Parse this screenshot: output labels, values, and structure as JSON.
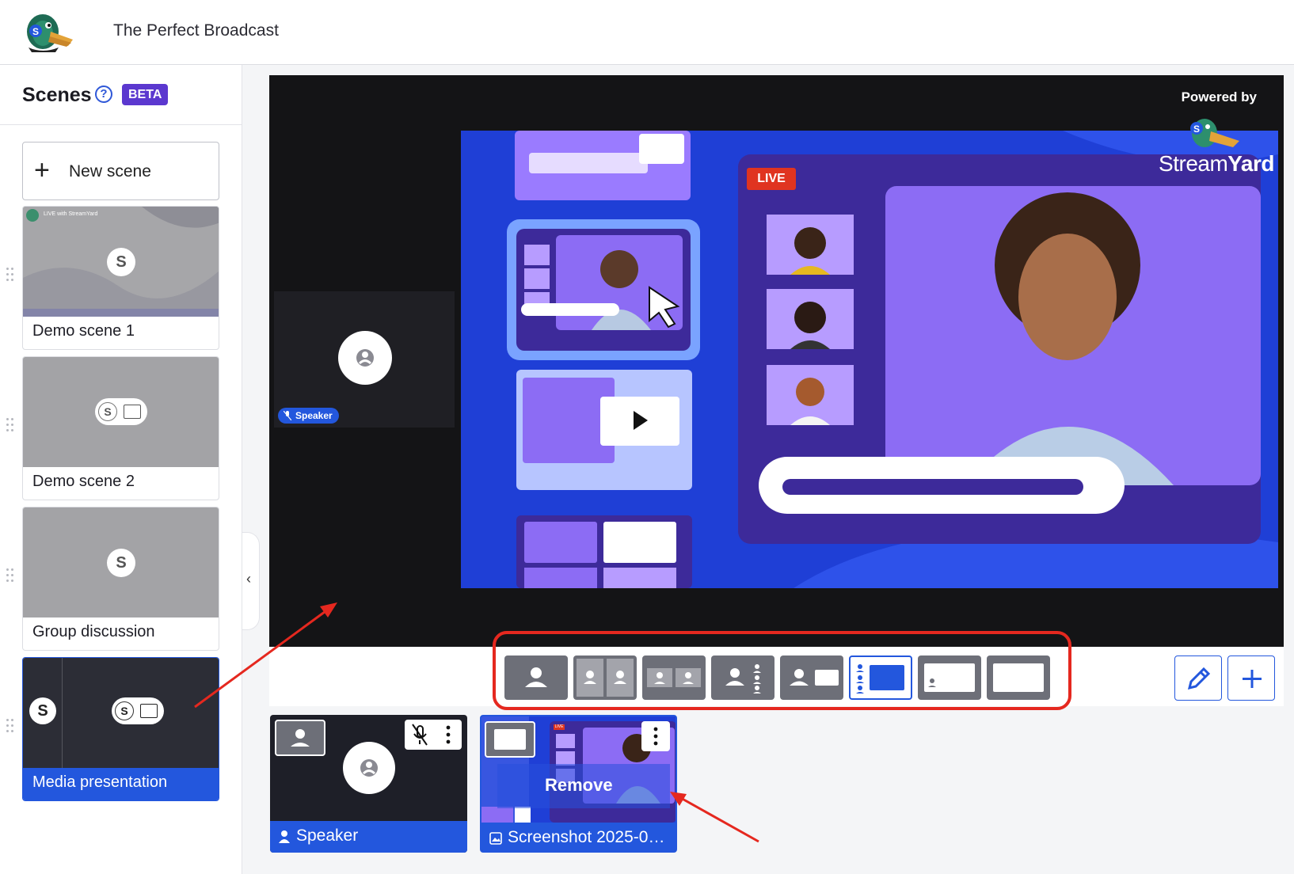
{
  "header": {
    "broadcast_title": "The Perfect Broadcast"
  },
  "sidebar": {
    "title": "Scenes",
    "help_symbol": "?",
    "beta_label": "BETA",
    "new_scene_label": "New scene",
    "scenes": [
      {
        "name": "Demo scene 1",
        "thumb_text": "LIVE with StreamYard",
        "avatar_letter": "S"
      },
      {
        "name": "Demo scene 2",
        "avatar_letter": "S"
      },
      {
        "name": "Group discussion",
        "avatar_letter": "S"
      },
      {
        "name": "Media presentation",
        "avatar_letter": "S",
        "active": true
      }
    ],
    "collapse_symbol": "‹"
  },
  "stage": {
    "speaker_badge": "Speaker",
    "powered_by": "Powered by",
    "brand_prefix": "Stream",
    "brand_suffix": "Yard",
    "live_label": "LIVE"
  },
  "layouts": {
    "selected_index": 5,
    "items": [
      "solo-layout",
      "cropped-layout",
      "group-layout",
      "screen-layout",
      "pip-layout",
      "sidebar-layout",
      "news-layout",
      "full-screen-layout"
    ]
  },
  "tools": {
    "edit_icon": "pencil-icon",
    "add_icon": "plus-icon"
  },
  "bottom_tiles": {
    "speaker_label": "Speaker",
    "media_label": "Screenshot 2025-0…",
    "remove_label": "Remove",
    "live_mini": "LIVE"
  },
  "colors": {
    "accent": "#2357dd",
    "beta": "#5b38cf",
    "annotation": "#e5281f",
    "stage_bg": "#141416",
    "media_bg": "#1f3fd6"
  }
}
